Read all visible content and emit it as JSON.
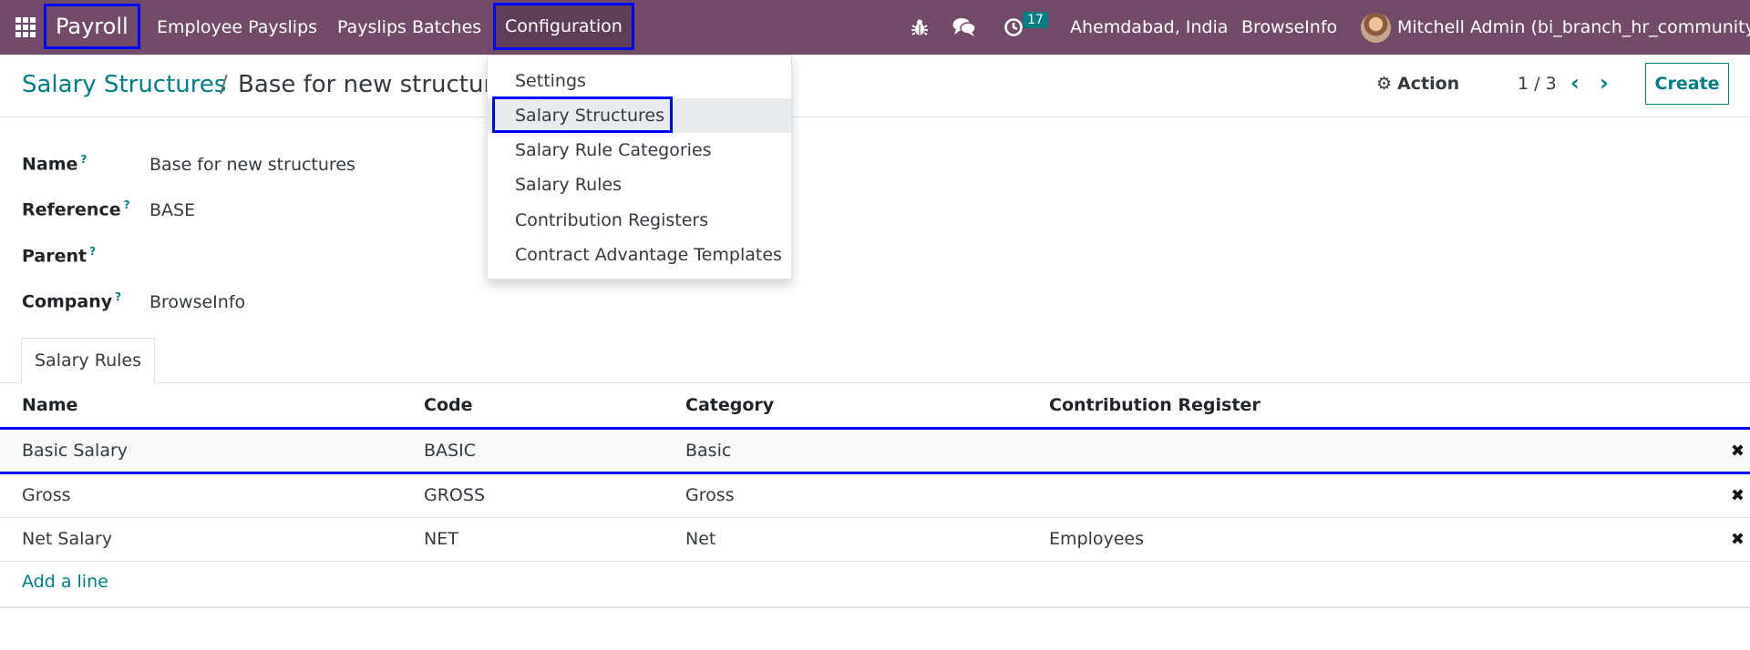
{
  "navbar": {
    "app_icon": "apps-grid-icon",
    "brand": "Payroll",
    "menu": {
      "employee_payslips": "Employee Payslips",
      "payslips_batches": "Payslips Batches",
      "configuration": "Configuration"
    },
    "icons": [
      "bug-icon",
      "chat-icon",
      "clock-icon"
    ],
    "activity_count": "17",
    "location": "Ahemdabad, India",
    "company": "BrowseInfo",
    "user": "Mitchell Admin (bi_branch_hr_community)",
    "color": "#714b67"
  },
  "dropdown": {
    "items": [
      "Settings",
      "Salary Structures",
      "Salary Rule Categories",
      "Salary Rules",
      "Contribution Registers",
      "Contract Advantage Templates"
    ],
    "active_index": 1
  },
  "breadcrumb": {
    "parent": "Salary Structures",
    "separator": "/",
    "current": "Base for new structures"
  },
  "controls": {
    "action_label": "Action",
    "pager": "1 / 3",
    "create_label": "Create",
    "accent_color": "#017e84"
  },
  "form": {
    "fields": [
      {
        "label": "Name",
        "help": "?",
        "value": "Base for new structures"
      },
      {
        "label": "Reference",
        "help": "?",
        "value": "BASE"
      },
      {
        "label": "Parent",
        "help": "?",
        "value": ""
      },
      {
        "label": "Company",
        "help": "?",
        "value": "BrowseInfo"
      }
    ]
  },
  "tabs": [
    "Salary Rules"
  ],
  "table": {
    "columns": [
      "Name",
      "Code",
      "Category",
      "Contribution Register"
    ],
    "rows": [
      {
        "name": "Basic Salary",
        "code": "BASIC",
        "category": "Basic",
        "register": ""
      },
      {
        "name": "Gross",
        "code": "GROSS",
        "category": "Gross",
        "register": ""
      },
      {
        "name": "Net Salary",
        "code": "NET",
        "category": "Net",
        "register": "Employees"
      }
    ],
    "delete_icon": "✖",
    "add_line": "Add a line"
  }
}
